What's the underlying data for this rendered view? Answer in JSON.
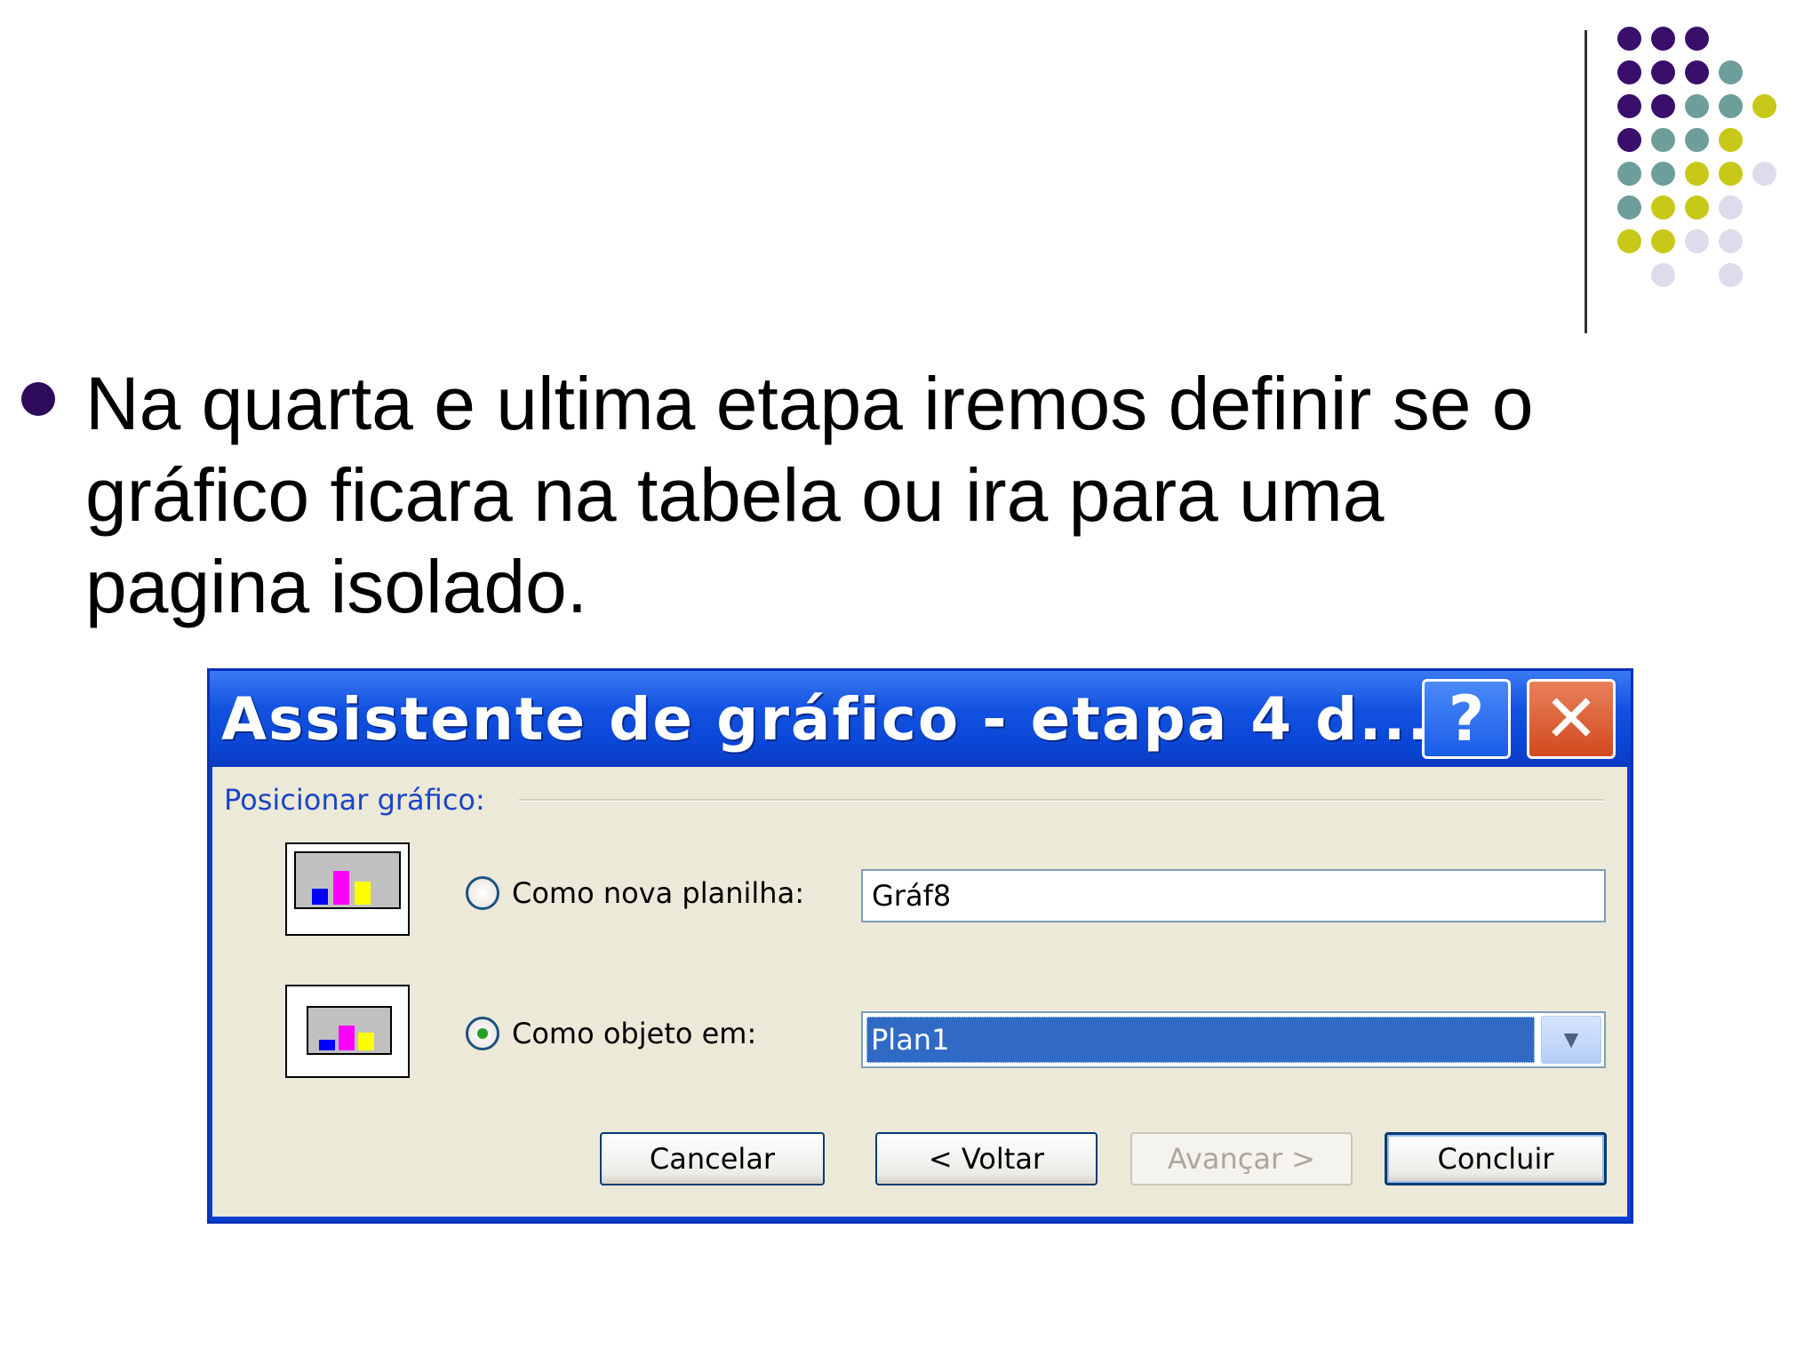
{
  "slide": {
    "bullet_text": "Na quarta e ultima etapa iremos definir se o gráfico ficara na tabela ou ira para uma pagina isolado.",
    "colors": {
      "purple": "#3a0f6b",
      "teal": "#6e9e9b",
      "olive": "#c8c818",
      "lavender": "#dcdcec"
    }
  },
  "dialog": {
    "title": "Assistente de gráfico - etapa 4 d...",
    "help_label": "?",
    "close_label": "✕",
    "group_label": "Posicionar gráfico:",
    "options": [
      {
        "label": "Como nova planilha:",
        "value": "Gráf8",
        "checked": false
      },
      {
        "label": "Como objeto em:",
        "value": "Plan1",
        "checked": true
      }
    ],
    "dropdown_icon": "chevron-down-icon",
    "buttons": {
      "cancel": "Cancelar",
      "back": "< Voltar",
      "next": "Avançar >",
      "finish": "Concluir"
    }
  }
}
